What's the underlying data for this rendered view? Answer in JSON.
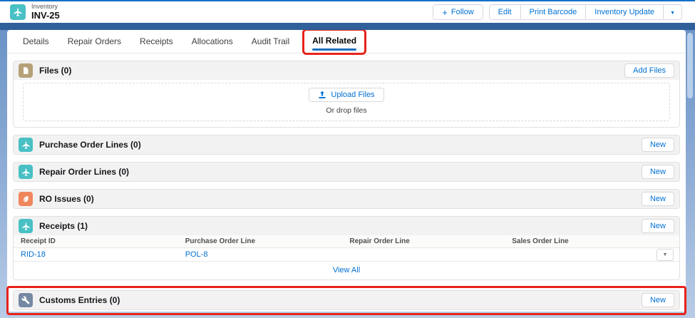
{
  "colors": {
    "brand_blue": "#0070d2",
    "highlight_red": "#e7231b",
    "active_tab_underline": "#1b6dbf",
    "entity_teal": "#48c0c4",
    "files_tan": "#b5a077",
    "ro_issues_orange": "#f0875c",
    "customs_slate": "#7589a2",
    "header_band_blue": "#30609a"
  },
  "header": {
    "record_type": "Inventory",
    "record_name": "INV-25",
    "entity_icon": "plane-icon",
    "follow_label": "Follow",
    "edit_label": "Edit",
    "print_barcode_label": "Print Barcode",
    "inventory_update_label": "Inventory Update"
  },
  "tabs": {
    "active": "All Related",
    "items": [
      {
        "label": "Details"
      },
      {
        "label": "Repair Orders"
      },
      {
        "label": "Receipts"
      },
      {
        "label": "Allocations"
      },
      {
        "label": "Audit Trail"
      },
      {
        "label": "All Related"
      }
    ]
  },
  "files": {
    "icon": "file-icon",
    "title": "Files (0)",
    "add_button_label": "Add Files",
    "upload_button_label": "Upload Files",
    "upload_icon": "upload-icon",
    "drop_hint": "Or drop files"
  },
  "purchase_order_lines": {
    "icon": "plane-icon",
    "title": "Purchase Order Lines (0)",
    "new_button_label": "New"
  },
  "repair_order_lines": {
    "icon": "plane-icon",
    "title": "Repair Order Lines (0)",
    "new_button_label": "New"
  },
  "ro_issues": {
    "icon": "leaf-icon",
    "title": "RO Issues (0)",
    "new_button_label": "New"
  },
  "receipts_list": {
    "icon": "plane-icon",
    "title": "Receipts (1)",
    "new_button_label": "New",
    "columns": [
      "Receipt ID",
      "Purchase Order Line",
      "Repair Order Line",
      "Sales Order Line"
    ],
    "rows": [
      {
        "receipt_id": "RID-18",
        "purchase_order_line": "POL-8",
        "repair_order_line": "",
        "sales_order_line": ""
      }
    ],
    "view_all_label": "View All"
  },
  "customs_entries": {
    "icon": "wrench-icon",
    "title": "Customs Entries (0)",
    "new_button_label": "New"
  }
}
